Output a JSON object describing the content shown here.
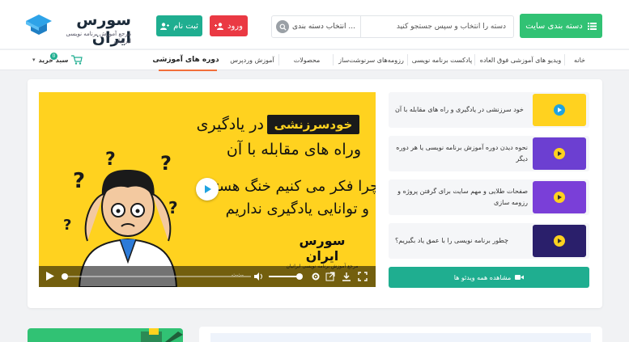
{
  "header": {
    "logo": {
      "title": "سورس ایران",
      "subtitle": "مرجع آموزش برنامه نویسی ایرانیان"
    },
    "signup_label": "ثبت نام",
    "login_label": "ورود",
    "search": {
      "category_label": "انتخاب دسته بندی ...",
      "placeholder": "دسته را انتخاب و سپس جستجو کنید"
    },
    "category_button_label": "دسته بندی سایت",
    "colors": {
      "green": "#31c274",
      "teal": "#1fae90",
      "red": "#ea3943"
    }
  },
  "nav": {
    "items": [
      {
        "label": "خانه"
      },
      {
        "label": "ویدیو های آموزشی فوق العاده"
      },
      {
        "label": "پادکست برنامه نویسی"
      },
      {
        "label": "رزومه‌های سرنوشت‌ساز"
      },
      {
        "label": "محصولات"
      },
      {
        "label": "آموزش وردپرس"
      },
      {
        "label": "دوره های آموزشی"
      }
    ],
    "cart_label": "سبد خرید",
    "cart_count": "0"
  },
  "video": {
    "badge": "خودسرزنشی",
    "line1": "در یادگیری",
    "line2": "وراه های مقابله با آن",
    "line3": "چرا فکر می کنیم خنگ هستیم",
    "line4": "و توانایی یادگیری نداریم",
    "logo_title": "سورس ایران",
    "logo_subtitle": "مرجع آموزش برنامه نویسی ایرانیان",
    "time": "-:--:--",
    "accent": "#ffd21f"
  },
  "video_list": [
    {
      "title": "خود سرزنشی در یادگیری و راه های مقابله با آن",
      "thumb_color": "#ffd21f"
    },
    {
      "title": "نحوه دیدن دوره آموزش برنامه نویسی یا هر دوره دیگر",
      "thumb_color": "#6c3fd1"
    },
    {
      "title": "صفحات طلایی و مهم سایت برای گرفتن پروژه و رزومه سازی",
      "thumb_color": "#7a3fd8"
    },
    {
      "title": "چطور برنامه نویسی را با عمق یاد بگیریم؟",
      "thumb_color": "#2a1f6b"
    }
  ],
  "all_videos_label": "مشاهده همه ویدئو ها"
}
